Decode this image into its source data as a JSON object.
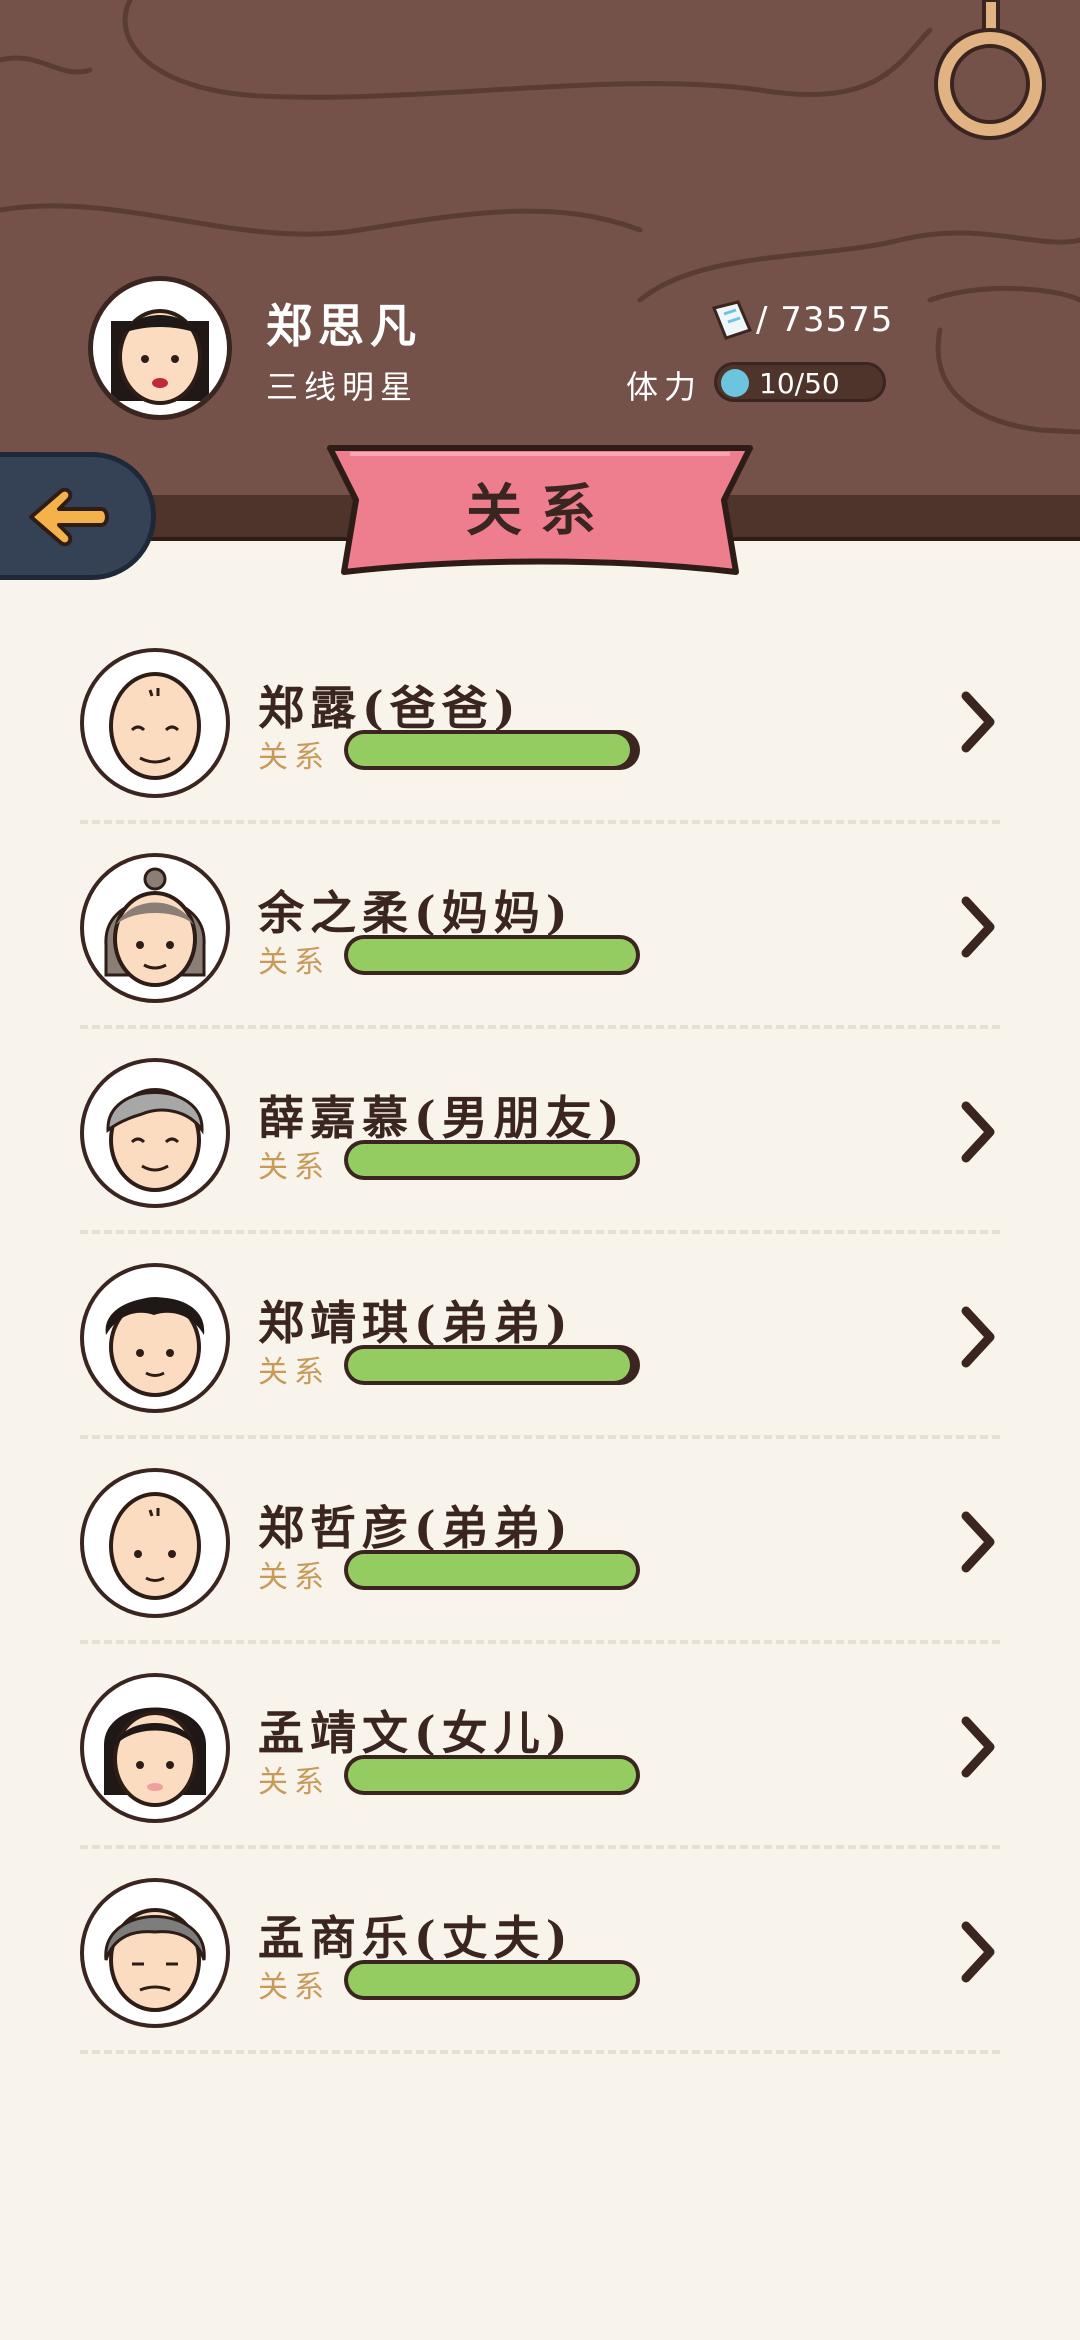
{
  "player": {
    "name": "郑思凡",
    "title": "三线明星",
    "money": "73575",
    "stamina_label": "体力",
    "stamina": "10/50"
  },
  "page_title": "关系",
  "relationship_label": "关系",
  "relationships": [
    {
      "name": "郑露(爸爸)",
      "relationship_level": 0.98
    },
    {
      "name": "余之柔(妈妈)",
      "relationship_level": 1.0
    },
    {
      "name": "薛嘉慕(男朋友)",
      "relationship_level": 1.0
    },
    {
      "name": "郑靖琪(弟弟)",
      "relationship_level": 0.98
    },
    {
      "name": "郑哲彦(弟弟)",
      "relationship_level": 1.0
    },
    {
      "name": "孟靖文(女儿)",
      "relationship_level": 1.0
    },
    {
      "name": "孟商乐(丈夫)",
      "relationship_level": 1.0
    }
  ],
  "colors": {
    "header_wood": "#74524a",
    "banner_pink": "#ee7e8e",
    "bar_green": "#94cc62",
    "back_button": "#354256",
    "arrow_orange": "#f6b24a"
  }
}
